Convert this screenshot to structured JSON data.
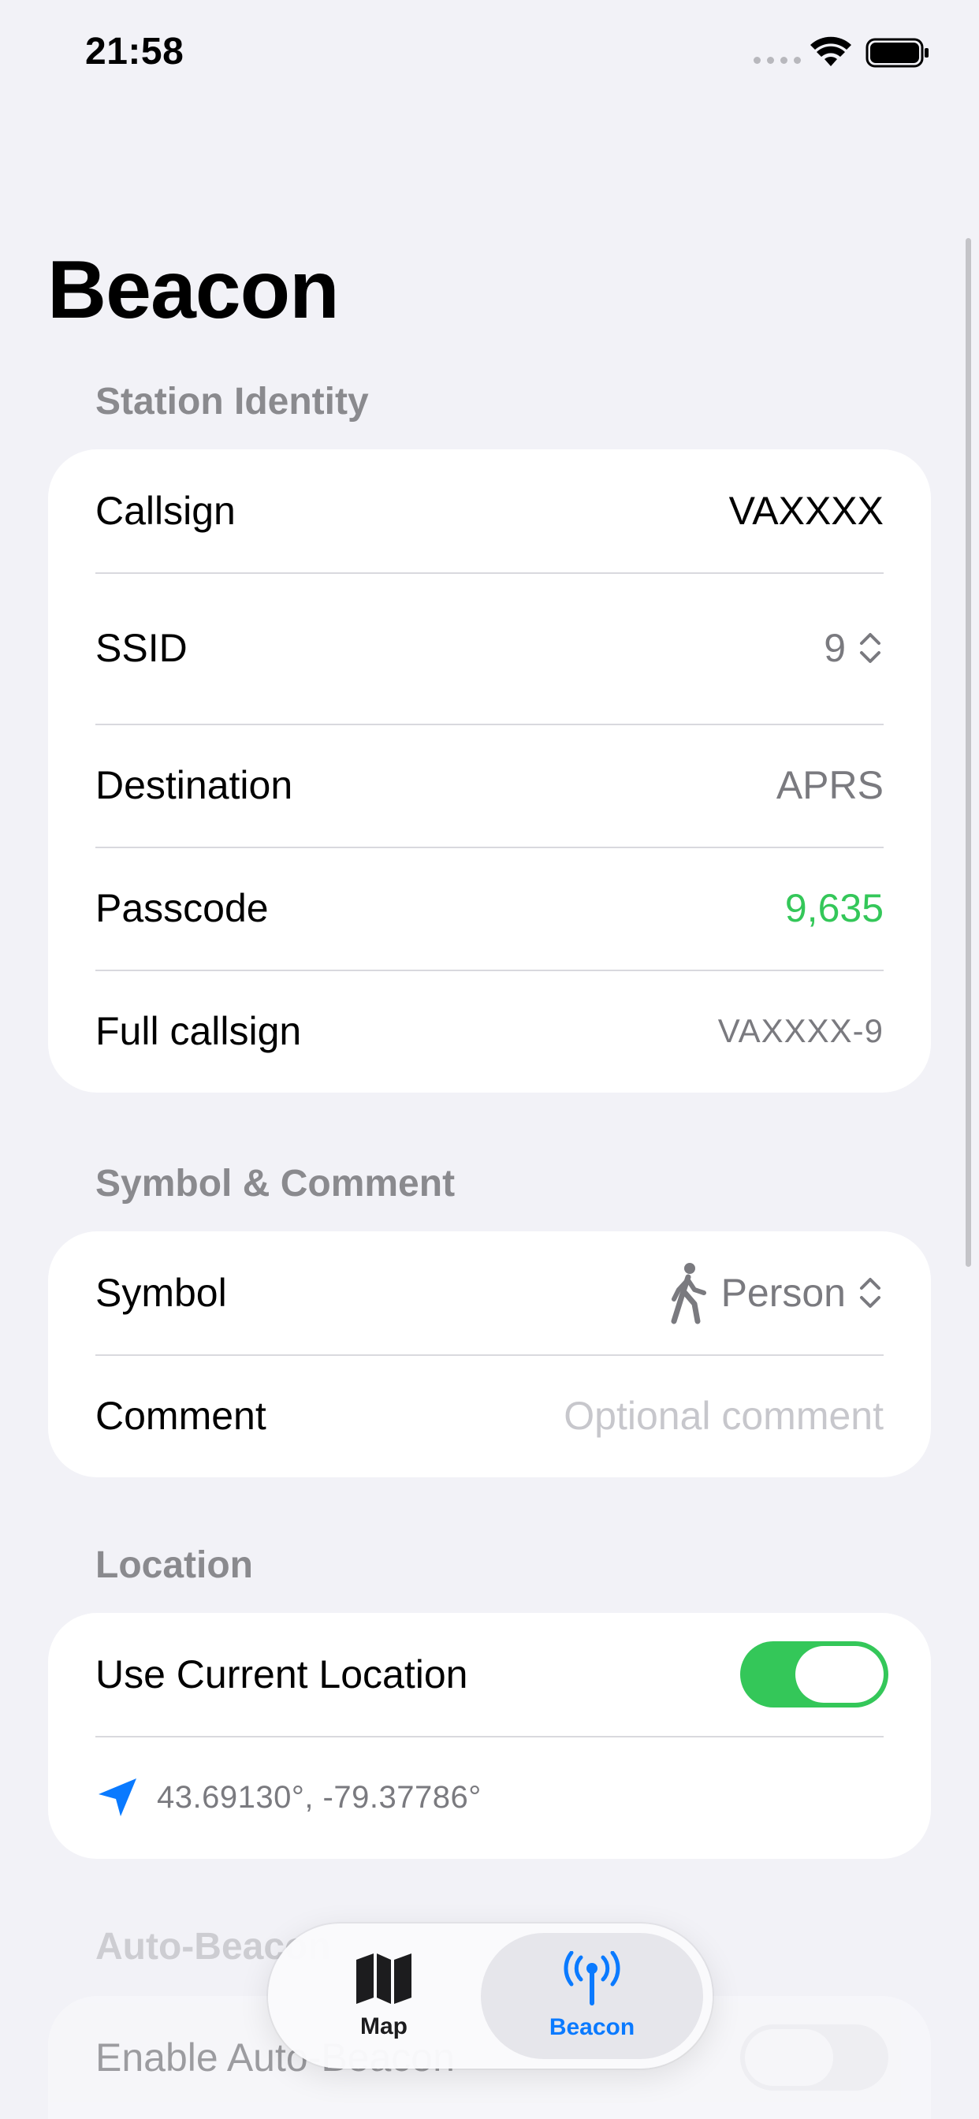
{
  "status_bar": {
    "time": "21:58"
  },
  "title": "Beacon",
  "sections": {
    "station_identity": {
      "header": "Station Identity",
      "callsign_label": "Callsign",
      "callsign_value": "VAXXXX",
      "ssid_label": "SSID",
      "ssid_value": "9",
      "destination_label": "Destination",
      "destination_value": "APRS",
      "passcode_label": "Passcode",
      "passcode_value": "9,635",
      "full_callsign_label": "Full callsign",
      "full_callsign_value": "VAXXXX-9"
    },
    "symbol_comment": {
      "header": "Symbol & Comment",
      "symbol_label": "Symbol",
      "symbol_value": "Person",
      "symbol_icon": "person-walking-icon",
      "comment_label": "Comment",
      "comment_placeholder": "Optional comment"
    },
    "location": {
      "header": "Location",
      "use_current_label": "Use Current Location",
      "use_current_enabled": true,
      "coordinates": "43.69130°, -79.37786°"
    },
    "auto_beacon": {
      "header": "Auto-Beacon",
      "enable_label": "Enable Auto-Beacon",
      "enabled": false
    }
  },
  "tab_bar": {
    "tabs": [
      {
        "label": "Map",
        "icon": "map-icon",
        "selected": false
      },
      {
        "label": "Beacon",
        "icon": "antenna-icon",
        "selected": true
      }
    ]
  },
  "colors": {
    "accent": "#0a7aff",
    "green": "#34c759",
    "background": "#f2f2f7",
    "secondary_text": "#8a8a8e"
  }
}
